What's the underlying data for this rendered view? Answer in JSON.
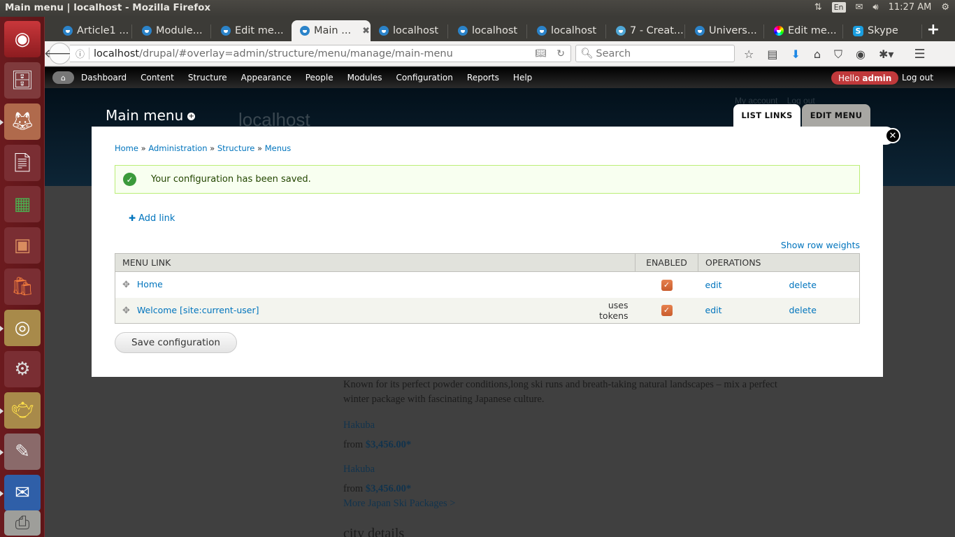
{
  "system_panel": {
    "window_title": "Main menu | localhost - Mozilla Firefox",
    "keyboard_layout": "En",
    "clock": "11:27 AM",
    "indicators": [
      "network-icon",
      "keyboard-icon",
      "mail-icon",
      "volume-icon",
      "power-icon"
    ]
  },
  "launcher": {
    "items": [
      {
        "name": "ubuntu-dash",
        "icon": "ubuntu-icon"
      },
      {
        "name": "files",
        "icon": "file-cabinet-icon"
      },
      {
        "name": "firefox",
        "icon": "firefox-icon"
      },
      {
        "name": "libreoffice-writer",
        "icon": "writer-icon"
      },
      {
        "name": "libreoffice-calc",
        "icon": "calc-icon"
      },
      {
        "name": "libreoffice-impress",
        "icon": "impress-icon"
      },
      {
        "name": "software-center",
        "icon": "shopping-bag-icon"
      },
      {
        "name": "chrome",
        "icon": "chrome-icon"
      },
      {
        "name": "system-settings",
        "icon": "settings-wrench-icon"
      },
      {
        "name": "genie-lamp",
        "icon": "lamp-icon"
      },
      {
        "name": "text-editor",
        "icon": "text-editor-icon"
      },
      {
        "name": "thunderbird",
        "icon": "thunderbird-icon"
      },
      {
        "name": "scanner",
        "icon": "scanner-icon"
      }
    ]
  },
  "browser": {
    "tabs": [
      {
        "label": "Article1 ...",
        "icon": "drupal-icon",
        "active": false
      },
      {
        "label": "Module...",
        "icon": "drupal-icon",
        "active": false
      },
      {
        "label": "Edit me...",
        "icon": "drupal-icon",
        "active": false
      },
      {
        "label": "Main ...",
        "icon": "drupal-icon",
        "active": true
      },
      {
        "label": "localhost",
        "icon": "drupal-icon",
        "active": false
      },
      {
        "label": "localhost",
        "icon": "drupal-icon",
        "active": false
      },
      {
        "label": "localhost",
        "icon": "drupal-icon",
        "active": false
      },
      {
        "label": "7 - Creat...",
        "icon": "droplet-icon",
        "active": false
      },
      {
        "label": "Univers...",
        "icon": "drupal-icon",
        "active": false
      },
      {
        "label": "Edit me...",
        "icon": "color-wheel-icon",
        "active": false
      },
      {
        "label": "Skype",
        "icon": "skype-icon",
        "active": false
      }
    ],
    "url_host": "localhost",
    "url_path": "/drupal/#overlay=admin/structure/menu/manage/main-menu",
    "search_placeholder": "Search"
  },
  "drupal_toolbar": {
    "menu": [
      "Dashboard",
      "Content",
      "Structure",
      "Appearance",
      "People",
      "Modules",
      "Configuration",
      "Reports",
      "Help"
    ],
    "hello_prefix": "Hello",
    "username": "admin",
    "logout": "Log out"
  },
  "background_page": {
    "site_name": "localhost",
    "my_account": "My account",
    "log_out": "Log out",
    "description_line1": "Known for its perfect powder conditions,long ski runs and breath-taking natural landscapes – mix a perfect",
    "description_line2": "winter package with fascinating Japanese culture.",
    "packages": [
      {
        "name": "Hakuba",
        "from": "from",
        "price": "$3,456.00*"
      },
      {
        "name": "Hakuba",
        "from": "from",
        "price": "$3,456.00*"
      }
    ],
    "more_link": "More Japan Ski Packages >",
    "section_heading": "city details"
  },
  "overlay": {
    "title": "Main menu",
    "tabs": [
      {
        "label": "LIST LINKS",
        "active": true
      },
      {
        "label": "EDIT MENU",
        "active": false
      }
    ],
    "breadcrumb": [
      "Home",
      "Administration",
      "Structure",
      "Menus"
    ],
    "breadcrumb_separator": "»",
    "status_message": "Your configuration has been saved.",
    "add_link": "Add link",
    "show_row_weights": "Show row weights",
    "table": {
      "headers": [
        "MENU LINK",
        "ENABLED",
        "OPERATIONS"
      ],
      "rows": [
        {
          "link": "Home",
          "note": "",
          "enabled": true,
          "edit": "edit",
          "delete": "delete"
        },
        {
          "link": "Welcome [site:current-user]",
          "note": "uses tokens",
          "enabled": true,
          "edit": "edit",
          "delete": "delete"
        }
      ]
    },
    "save_button": "Save configuration"
  }
}
